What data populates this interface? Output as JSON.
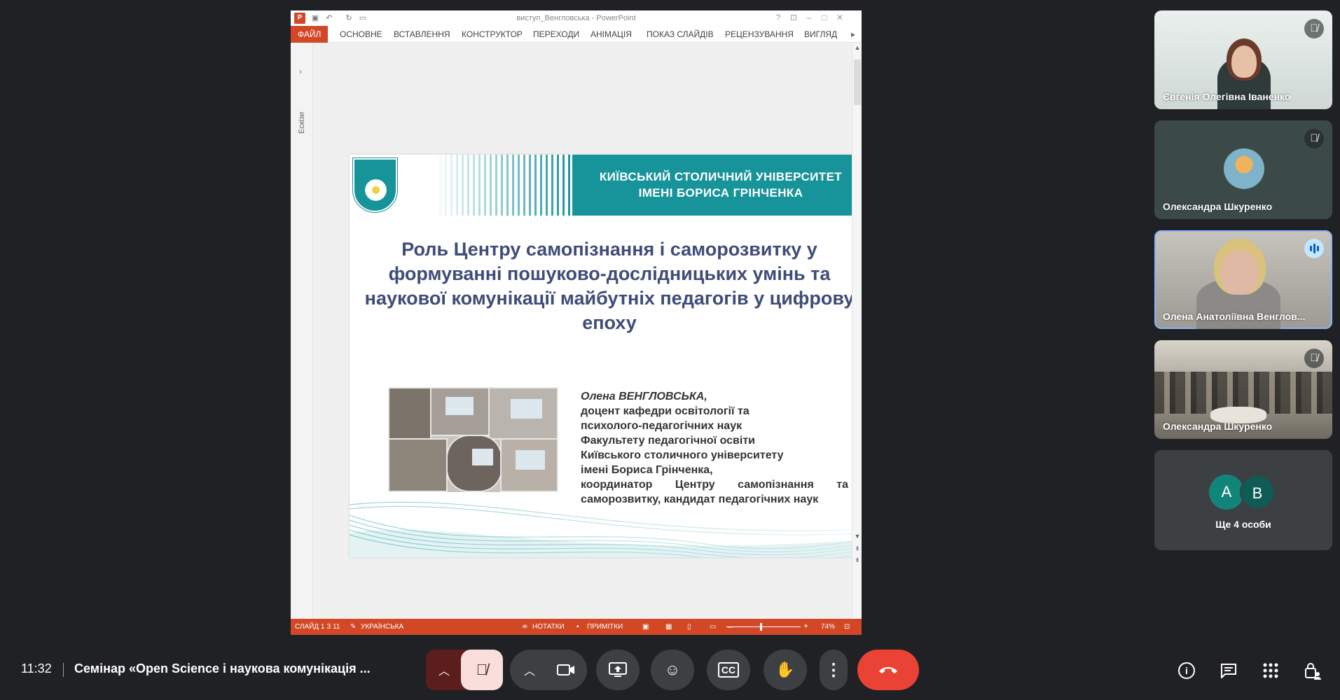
{
  "ppt": {
    "window_title": "виступ_Венгловська - PowerPoint",
    "ribbon_tabs": [
      "ФАЙЛ",
      "ОСНОВНЕ",
      "ВСТАВЛЕННЯ",
      "КОНСТРУКТОР",
      "ПЕРЕХОДИ",
      "АНІМАЦІЯ",
      "ПОКАЗ СЛАЙДІВ",
      "РЕЦЕНЗУВАННЯ",
      "ВИГЛЯД"
    ],
    "thumbnail_pane_label": "Ескізи",
    "slide_number": "1",
    "status": {
      "slide": "СЛАЙД 1 З 11",
      "language": "УКРАЇНСЬКА",
      "notes": "НОТАТКИ",
      "comments": "ПРИМІТКИ",
      "zoom": "74%"
    }
  },
  "slide": {
    "university_line1": "КИЇВСЬКИЙ СТОЛИЧНИЙ УНІВЕРСИТЕТ",
    "university_line2": "ІМЕНІ БОРИСА ГРІНЧЕНКА",
    "title": "Роль Центру самопізнання і саморозвитку у формуванні пошуково-дослідницьких умінь та наукової комунікації майбутніх педагогів у цифрову епоху",
    "author_name": "Олена ВЕНГЛОВСЬКА,",
    "author_lines": [
      "доцент кафедри освітології та",
      "психолого-педагогічних наук",
      "Факультету педагогічної освіти",
      "Київського столичного університету",
      "імені Бориса Грінченка,",
      "координатор Центру самопізнання та",
      "саморозвитку, кандидат педагогічних наук"
    ]
  },
  "participants": [
    {
      "name": "Євгенія Олегівна Іваненко",
      "muted": true
    },
    {
      "name": "Олександра Шкуренко",
      "muted": true
    },
    {
      "name": "Олена Анатоліївна Венглов...",
      "speaking": true
    },
    {
      "name": "Олександра Шкуренко",
      "muted": true
    }
  ],
  "others": {
    "initials": [
      "A",
      "B"
    ],
    "label": "Ще 4 особи",
    "colors": [
      "#12857a",
      "#0e5c55"
    ]
  },
  "bottom": {
    "time": "11:32",
    "meeting_title": "Семінар «Open Science і наукова комунікація ..."
  },
  "colors": {
    "accent_red": "#ea4335",
    "teal": "#17939a",
    "ppt_orange": "#d24726"
  }
}
